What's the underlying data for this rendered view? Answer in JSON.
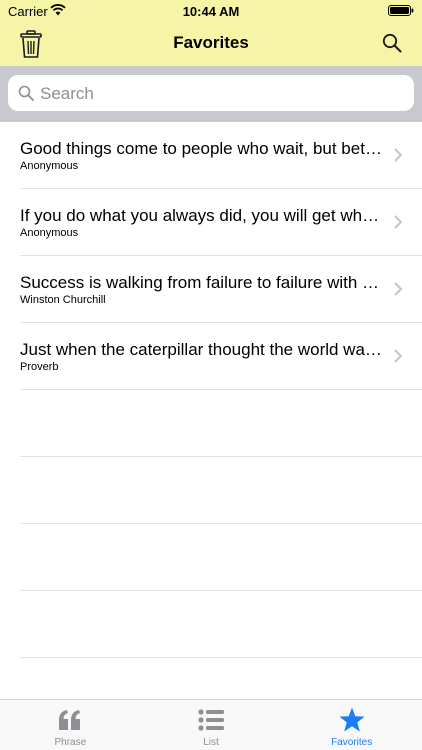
{
  "status_bar": {
    "carrier": "Carrier",
    "time": "10:44 AM"
  },
  "nav": {
    "title": "Favorites",
    "left_icon": "trash-icon",
    "right_icon": "search-icon"
  },
  "search": {
    "placeholder": "Search",
    "value": ""
  },
  "favorites": [
    {
      "quote": "Good things come to people who wait, but better things come to those who go out and get them.",
      "author": "Anonymous"
    },
    {
      "quote": "If you do what you always did, you will get what you always got.",
      "author": "Anonymous"
    },
    {
      "quote": "Success is walking from failure to failure with no loss of enthusiasm.",
      "author": "Winston Churchill"
    },
    {
      "quote": "Just when the caterpillar thought the world was ending, he turned into a butterfly.",
      "author": "Proverb"
    }
  ],
  "tabs": [
    {
      "label": "Phrase",
      "icon": "quote-icon",
      "active": false
    },
    {
      "label": "List",
      "icon": "list-icon",
      "active": false
    },
    {
      "label": "Favorites",
      "icon": "star-icon",
      "active": true
    }
  ],
  "colors": {
    "bar_background": "#f6f4a6",
    "accent": "#1a7ef5",
    "inactive_tab": "#8e8e93"
  }
}
